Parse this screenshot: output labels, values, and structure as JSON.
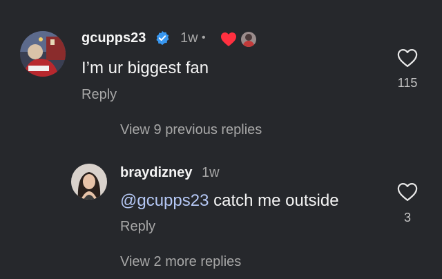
{
  "comment1": {
    "username": "gcupps23",
    "time": "1w",
    "dot": "•",
    "text": "I’m ur biggest fan",
    "reply_label": "Reply",
    "like_count": "115",
    "liked_by_creator_icon": "heart-icon",
    "verified_icon": "verified-badge-icon"
  },
  "view_previous": "View 9 previous replies",
  "comment2": {
    "username": "braydizney",
    "time": "1w",
    "mention": "@gcupps23",
    "text_rest": " catch me outside",
    "reply_label": "Reply",
    "like_count": "3"
  },
  "view_more": "View 2 more replies",
  "colors": {
    "background": "#26282c",
    "verified": "#3897f0",
    "heart": "#ff3040",
    "mention": "#b5c8f5",
    "secondary_text": "#a8a8a8"
  }
}
